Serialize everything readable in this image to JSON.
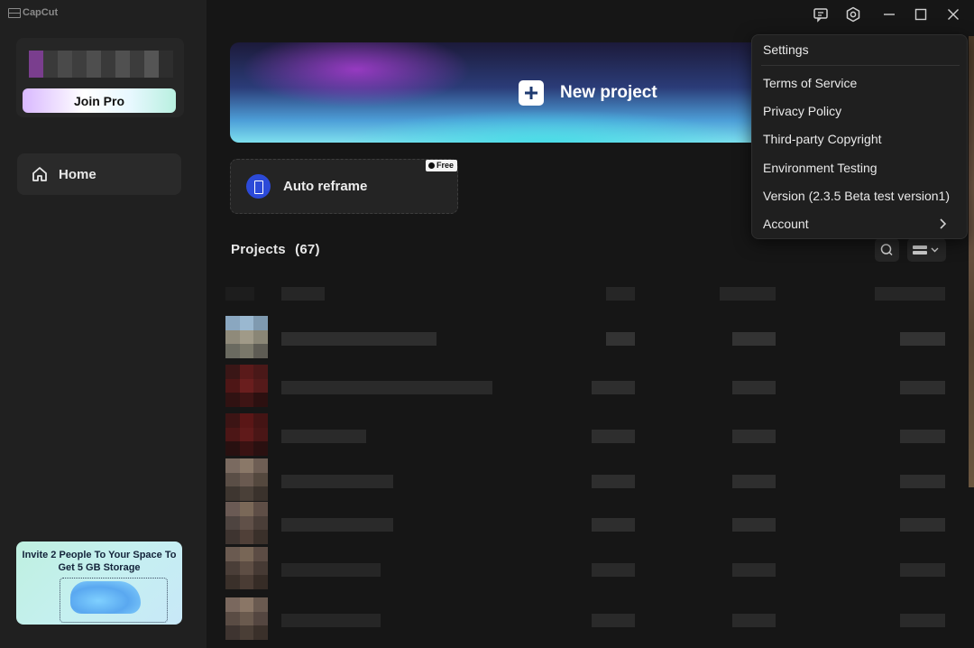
{
  "app": {
    "brand": "CapCut"
  },
  "sidebar": {
    "join_pro_label": "Join Pro",
    "home_label": "Home",
    "promo_text": "Invite 2 People To Your Space To Get 5 GB Storage"
  },
  "main": {
    "new_project_label": "New project",
    "auto_reframe_label": "Auto reframe",
    "free_badge": "Free",
    "projects_title": "Projects",
    "projects_count": "(67)"
  },
  "menu": {
    "items": [
      "Settings",
      "Terms of Service",
      "Privacy Policy",
      "Third-party Copyright",
      "Environment Testing",
      "Version (2.3.5 Beta test version1)",
      "Account"
    ]
  },
  "icons": {
    "titlebar": [
      "feedback-icon",
      "settings-gear-icon",
      "minimize-icon",
      "maximize-icon",
      "close-icon"
    ],
    "home": "home-icon",
    "search": "search-icon",
    "view": "list-view-icon",
    "account_chevron": "chevron-right-icon"
  },
  "colors": {
    "background": "#161616",
    "sidebar": "#202020",
    "accent_blue": "#2c4ad8"
  }
}
